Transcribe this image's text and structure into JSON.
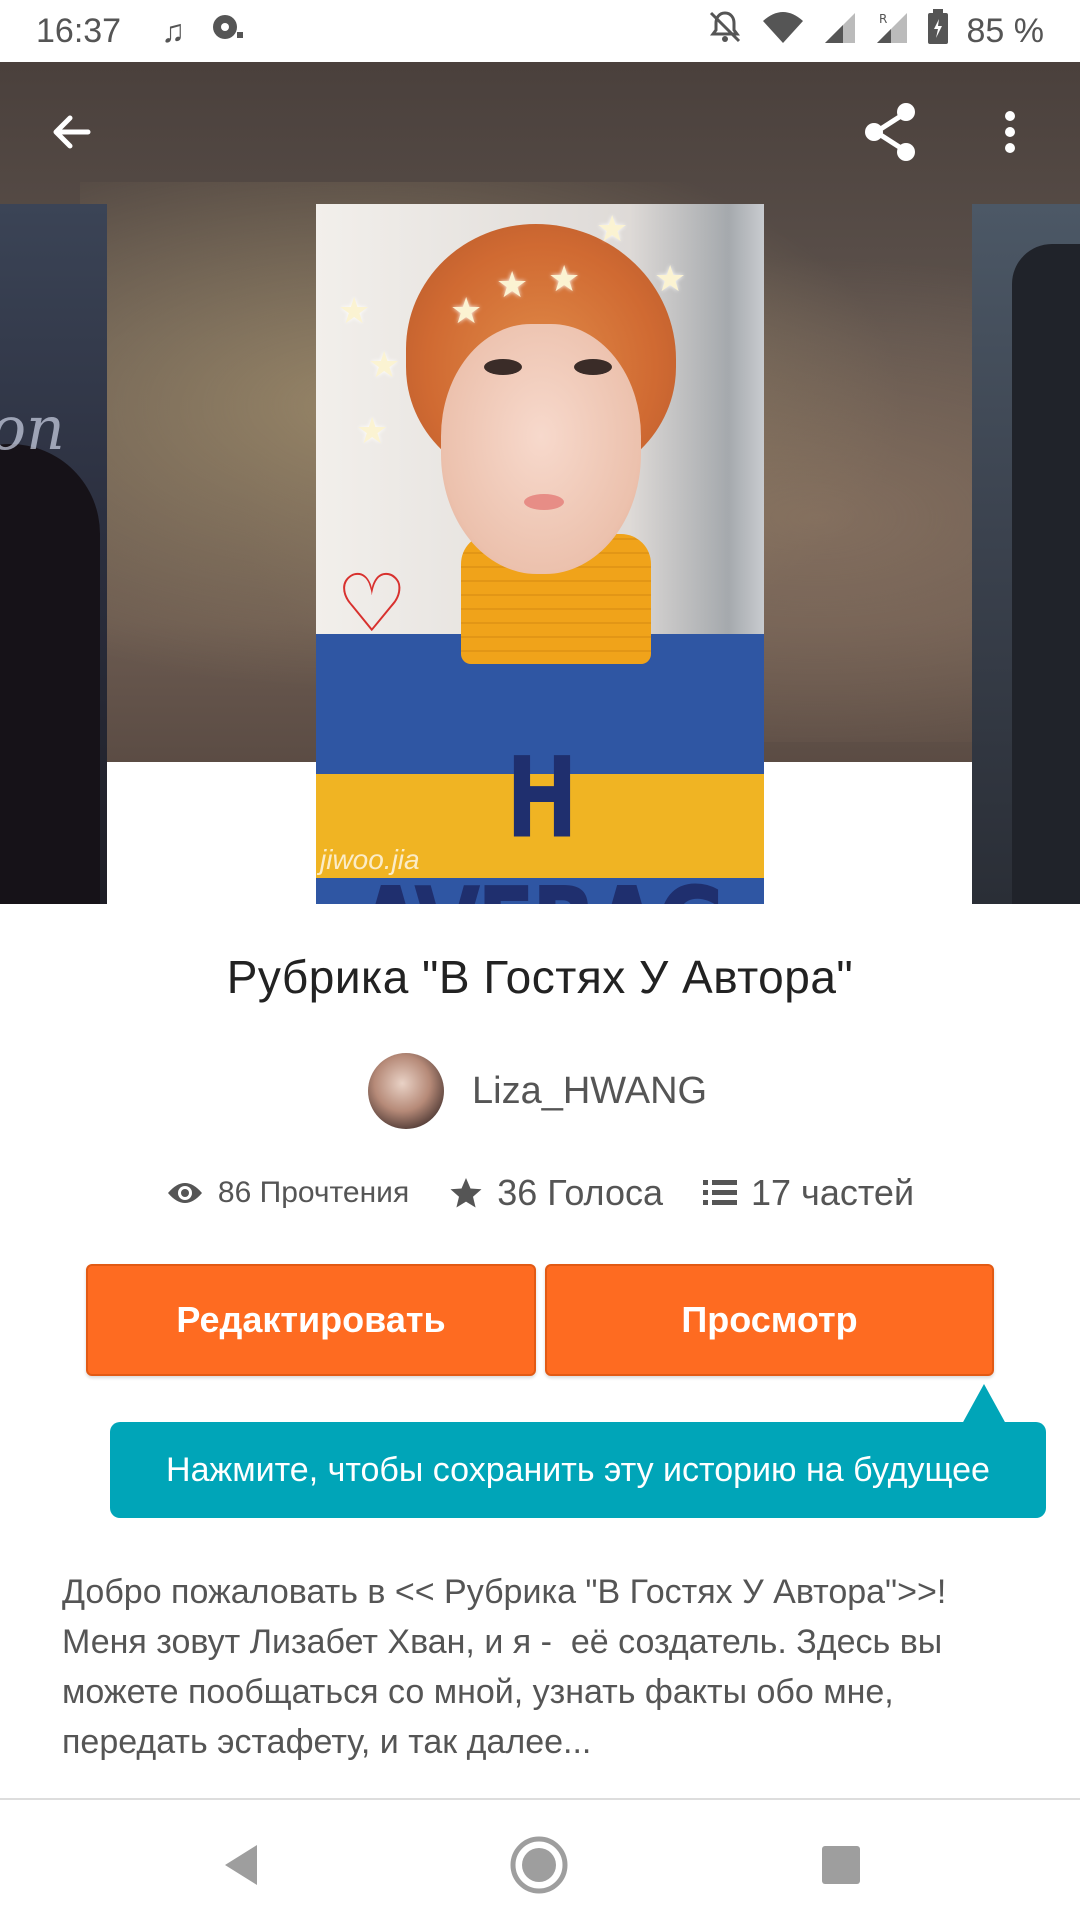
{
  "status_bar": {
    "time": "16:37",
    "battery": "85 %",
    "icons": [
      "music-note-icon",
      "media-icon",
      "dnd-bell-off-icon",
      "wifi-icon",
      "signal-icon",
      "signal-roaming-icon",
      "battery-icon"
    ]
  },
  "story": {
    "title": "Рубрика \"В Гостях У Автора\"",
    "author": "Liza_HWANG",
    "cover_watermark": "jiwoo.jia",
    "cover_text": "H AVERAG",
    "stats": {
      "reads": "86 Прочтения",
      "votes": "36 Голоса",
      "parts": "17 частей"
    },
    "description": "Добро пожаловать в << Рубрика \"В Гостях У Автора\">>!\nМеня зовут Лизабет Хван, и я -  её создатель. Здесь вы можете пообщаться со мной, узнать факты обо мне, передать эстафету, и так далее..."
  },
  "actions": {
    "edit_label": "Редактировать",
    "view_label": "Просмотр"
  },
  "tooltip": {
    "text": "Нажмите, чтобы сохранить эту историю на будущее"
  },
  "colors": {
    "accent": "#fe6b21",
    "tooltip": "#00a5b8",
    "text_primary": "#222222",
    "text_secondary": "#555555"
  }
}
